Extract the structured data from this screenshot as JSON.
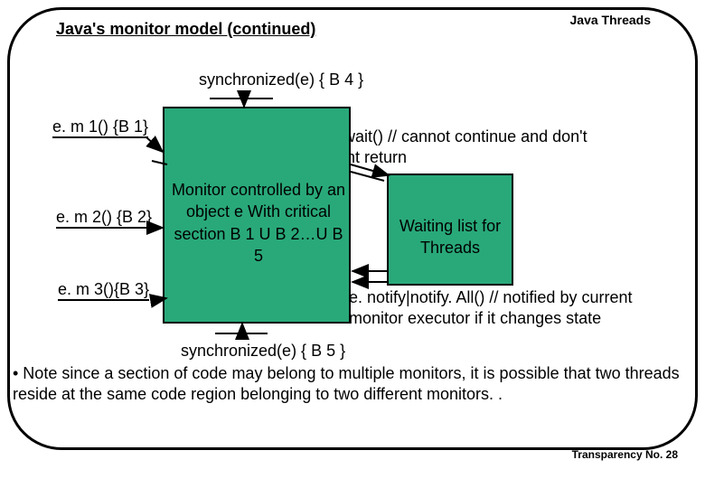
{
  "header": "Java Threads",
  "title": "Java's monitor model (continued)",
  "sync_top": "synchronized(e) { B 4 }",
  "sync_bottom": "synchronized(e) { B 5 }",
  "callers": {
    "c1": "e. m 1() {B 1}",
    "c2": "e. m 2() {B 2}",
    "c3": "e. m 3(){B 3}"
  },
  "monitor_label": "Monitor controlled by an object e With critical section B 1 U B 2…U B 5",
  "waitlist_label": "Waiting list for Threads",
  "wait_anno": "e. wait() // cannot continue and don't want return",
  "notify_anno": "e. notify|notify. All() // notified by current monitor executor if it changes state",
  "note": "• Note since a section of code may belong to multiple monitors, it is possible that two threads reside at the same code region belonging to two different monitors. .",
  "footer": "Transparency No. 28",
  "colors": {
    "monitor_fill": "#29a97a"
  }
}
